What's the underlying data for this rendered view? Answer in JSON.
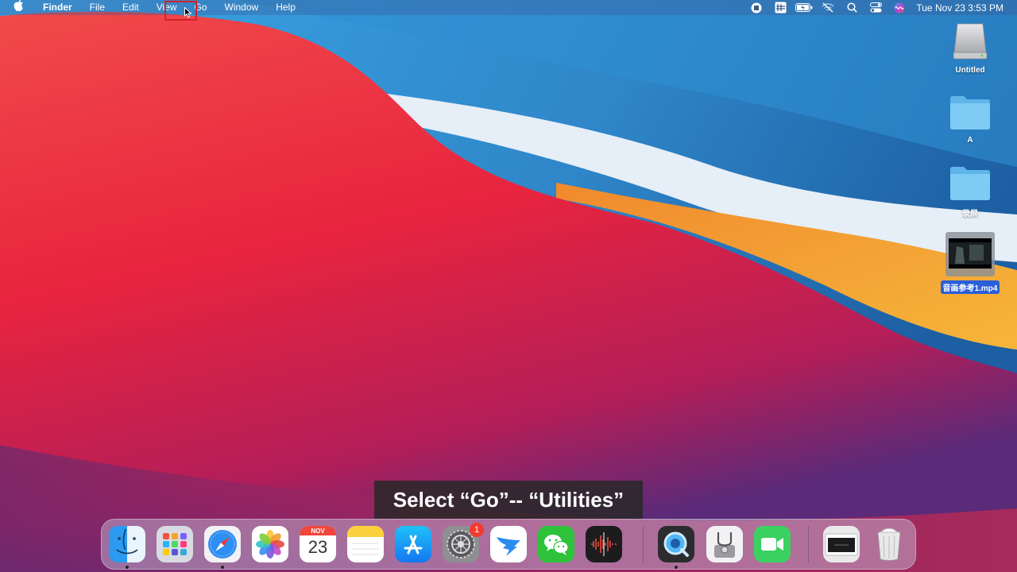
{
  "menubar": {
    "apple_icon": "apple-icon",
    "app_name": "Finder",
    "items": [
      "File",
      "Edit",
      "View",
      "Go",
      "Window",
      "Help"
    ],
    "highlighted_item": "Go",
    "status_icons": [
      "screen-record-stop-icon",
      "input-method-icon",
      "battery-charging-icon",
      "wifi-off-icon",
      "spotlight-search-icon",
      "control-center-icon",
      "siri-icon"
    ],
    "clock": "Tue Nov 23  3:53 PM"
  },
  "desktop": {
    "icons": [
      {
        "label": "Untitled",
        "icon": "external-drive-icon"
      },
      {
        "label": "A",
        "icon": "folder-icon"
      },
      {
        "label": "录屏",
        "icon": "folder-icon"
      },
      {
        "label": "音画参考1.mp4",
        "icon": "video-thumbnail-icon",
        "selected": true
      }
    ]
  },
  "caption": "Select “Go”-- “Utilities”",
  "dock": {
    "items": [
      {
        "name": "finder",
        "icon": "finder-icon",
        "running": true
      },
      {
        "name": "launchpad",
        "icon": "launchpad-icon",
        "running": false
      },
      {
        "name": "safari",
        "icon": "safari-icon",
        "running": true
      },
      {
        "name": "photos",
        "icon": "photos-icon",
        "running": false
      },
      {
        "name": "calendar",
        "icon": "calendar-icon",
        "running": false,
        "month": "NOV",
        "day": "23"
      },
      {
        "name": "notes",
        "icon": "notes-icon",
        "running": false
      },
      {
        "name": "app-store",
        "icon": "app-store-icon",
        "running": false
      },
      {
        "name": "system-preferences",
        "icon": "gear-icon",
        "running": false,
        "badge": "1"
      },
      {
        "name": "dingtalk",
        "icon": "dingtalk-icon",
        "running": false
      },
      {
        "name": "wechat",
        "icon": "wechat-icon",
        "running": false
      },
      {
        "name": "voice-memos",
        "icon": "voice-memos-icon",
        "running": false
      },
      {
        "name": "quicktime",
        "icon": "quicktime-icon",
        "running": true
      },
      {
        "name": "disk-utility",
        "icon": "disk-utility-icon",
        "running": false
      },
      {
        "name": "facetime",
        "icon": "facetime-icon",
        "running": false
      },
      {
        "name": "screen-recording",
        "icon": "window-thumbnail-icon",
        "running": false
      },
      {
        "name": "trash",
        "icon": "trash-icon",
        "running": false
      }
    ]
  },
  "colors": {
    "accent": "#2a5fd9",
    "highlight_box": "#d2232a",
    "badge": "#f23b30"
  }
}
